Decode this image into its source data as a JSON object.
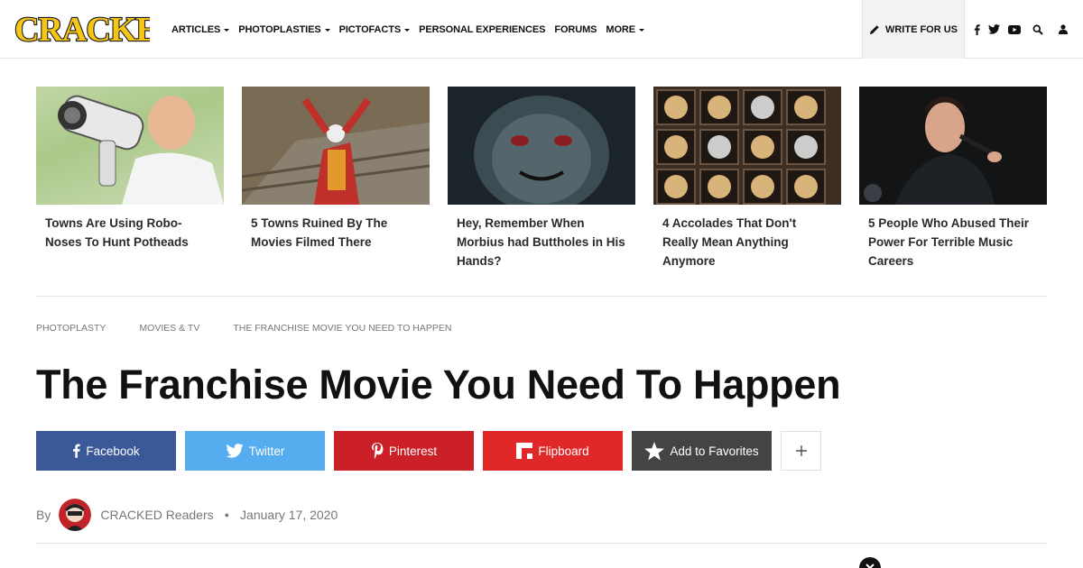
{
  "brand": {
    "logo_text": "CRACKED"
  },
  "nav": {
    "items": [
      {
        "label": "ARTICLES",
        "dropdown": true
      },
      {
        "label": "PHOTOPLASTIES",
        "dropdown": true
      },
      {
        "label": "PICTOFACTS",
        "dropdown": true
      },
      {
        "label": "PERSONAL EXPERIENCES",
        "dropdown": false
      },
      {
        "label": "FORUMS",
        "dropdown": false
      },
      {
        "label": "MORE",
        "dropdown": true
      }
    ],
    "write_label": "WRITE FOR US",
    "social_icons": [
      "facebook-icon",
      "twitter-icon",
      "youtube-icon",
      "search-icon",
      "user-icon"
    ]
  },
  "related": [
    {
      "title": "Towns Are Using Robo-Noses To Hunt Potheads"
    },
    {
      "title": "5 Towns Ruined By The Movies Filmed There"
    },
    {
      "title": "Hey, Remember When Morbius had Buttholes in His Hands?"
    },
    {
      "title": "4 Accolades That Don't Really Mean Anything Anymore"
    },
    {
      "title": "5 People Who Abused Their Power For Terrible Music Careers"
    }
  ],
  "breadcrumb": [
    "PHOTOPLASTY",
    "MOVIES & TV",
    "THE FRANCHISE MOVIE YOU NEED TO HAPPEN"
  ],
  "article": {
    "title": "The Franchise Movie You Need To Happen",
    "by_label": "By",
    "author": "CRACKED Readers",
    "date": "January 17, 2020"
  },
  "share": {
    "buttons": [
      {
        "label": "Facebook",
        "color": "#3b5998"
      },
      {
        "label": "Twitter",
        "color": "#55acee"
      },
      {
        "label": "Pinterest",
        "color": "#cb2027"
      },
      {
        "label": "Flipboard",
        "color": "#e12828"
      },
      {
        "label": "Add to Favorites",
        "color": "#444444"
      }
    ]
  },
  "colors": {
    "logo_fill": "#f5c518",
    "logo_outline": "#1a1a1a"
  }
}
